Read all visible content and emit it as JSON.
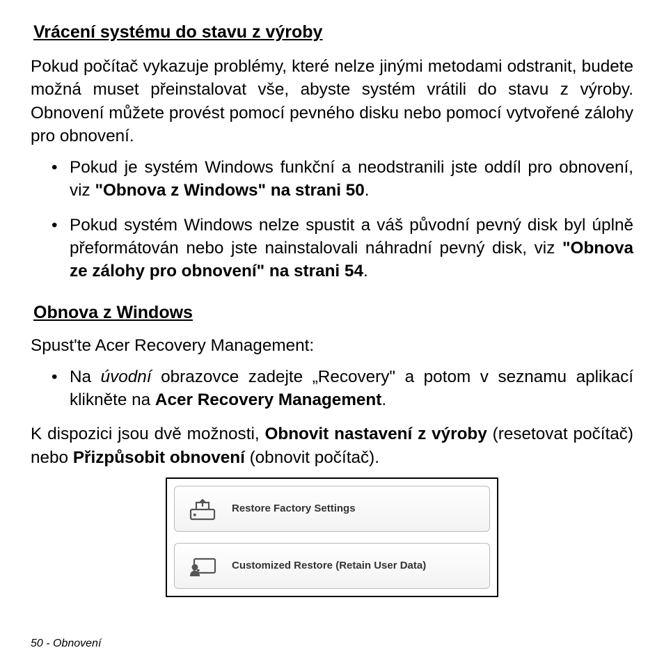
{
  "heading1": "Vrácení systému do stavu z výroby",
  "para1": "Pokud počítač vykazuje problémy, které nelze jinými metodami odstranit, budete možná muset přeinstalovat vše, abyste systém vrátili do stavu z výroby. Obnovení můžete provést pomocí pevného disku nebo pomocí vytvořené zálohy pro obnovení.",
  "bullet1": {
    "pre": "Pokud je systém Windows funkční a neodstranili jste oddíl pro obnovení, viz ",
    "bold": "\"Obnova z Windows\" na strani 50",
    "post": "."
  },
  "bullet2": {
    "pre": "Pokud systém Windows nelze spustit a váš původní pevný disk byl úplně přeformátován nebo jste nainstalovali náhradní pevný disk, viz ",
    "bold": "\"Obnova ze zálohy pro obnovení\" na strani 54",
    "post": "."
  },
  "heading2": "Obnova z Windows",
  "para2": "Spust'te Acer Recovery Management:",
  "bullet3": {
    "pre": "Na ",
    "ital": "úvodní",
    "mid": " obrazovce zadejte „Recovery\" a potom v seznamu aplikací klikněte na ",
    "bold": "Acer Recovery Management",
    "post": "."
  },
  "para3": {
    "pre": "K dispozici jsou dvě možnosti, ",
    "bold1": "Obnovit nastavení z výroby",
    "mid": " (resetovat počítač) nebo ",
    "bold2": "Přizpůsobit obnovení",
    "post": " (obnovit počítač)."
  },
  "buttons": {
    "restore_factory": "Restore Factory Settings",
    "customized_restore": "Customized Restore (Retain User Data)"
  },
  "footer": "50 - Obnovení"
}
